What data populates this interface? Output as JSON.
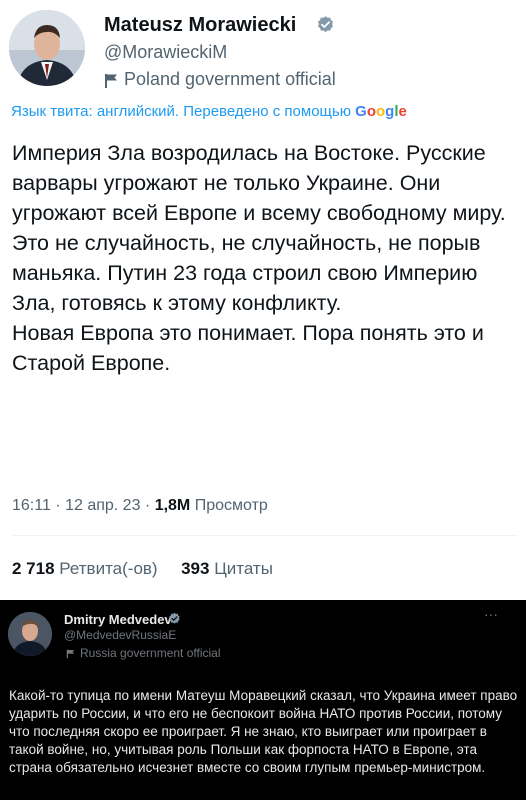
{
  "tweet1": {
    "name": "Mateusz Morawiecki",
    "handle": "@MorawieckiM",
    "affiliation": "Poland government official",
    "translate_note": "Язык твита: английский. Переведено с помощью",
    "translate_brand": "Google",
    "body_p1": "Империя Зла возродилась на Востоке. Русские варвары угрожают не только Украине. Они угрожают всей Европе и всему свободному миру. Это не случайность, не случайность, не порыв маньяка. Путин 23 года строил свою Империю Зла, готовясь к этому конфликту.",
    "body_p2": "Новая Европа это понимает. Пора понять это и Старой Европе.",
    "time": "16:11 · 12 апр. 23 ·",
    "views_count": "1,8M",
    "views_label": "Просмотр",
    "retweets_count": "2 718",
    "retweets_label": "Ретвита(-ов)",
    "quotes_count": "393",
    "quotes_label": "Цитаты"
  },
  "tweet2": {
    "name": "Dmitry Medvedev",
    "handle": "@MedvedevRussiaE",
    "affiliation": "Russia government official",
    "more": "···",
    "body": "Какой-то тупица по имени Матеуш Моравецкий сказал, что Украина имеет право ударить по России, и что его не беспокоит война НАТО против России, потому что последняя скоро ее проиграет. Я не знаю, кто выиграет или проиграет в такой войне, но, учитывая роль Польши как форпоста НАТО в Европе, эта страна обязательно исчезнет вместе со своим глупым премьер-министром."
  },
  "colors": {
    "link_blue": "#1d9bf0",
    "verified_gray": "#829aab",
    "text_dark": "#0f1419",
    "text_secondary": "#536471"
  },
  "icons": [
    "verified-badge-icon",
    "flag-icon",
    "more-icon"
  ]
}
